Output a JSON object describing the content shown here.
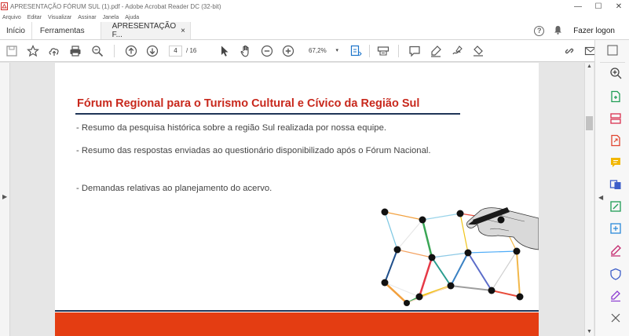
{
  "window": {
    "title": "APRESENTAÇÃO FÓRUM SUL (1).pdf - Adobe Acrobat Reader DC (32-bit)",
    "minimize": "—",
    "maximize": "☐",
    "close": "✕"
  },
  "menu": [
    "Arquivo",
    "Editar",
    "Visualizar",
    "Assinar",
    "Janela",
    "Ajuda"
  ],
  "tabs": {
    "home": "Início",
    "tools": "Ferramentas",
    "document": "APRESENTAÇÃO F...",
    "close_glyph": "×"
  },
  "header_right": {
    "help": "?",
    "login": "Fazer logon"
  },
  "toolbar": {
    "page_current": "4",
    "page_total": "/ 16",
    "zoom": "67,2%"
  },
  "slide": {
    "title": "Fórum Regional para o Turismo Cultural e Cívico da Região Sul",
    "bullets": [
      "- Resumo da pesquisa histórica sobre a região Sul realizada por nossa equipe.",
      "- Resumo das respostas enviadas ao questionário disponibilizado após o Fórum Nacional.",
      "- Demandas relativas ao planejamento do acervo."
    ]
  },
  "colors": {
    "title_red": "#c8281c",
    "rule_navy": "#1f3557",
    "footer_orange": "#e43d12"
  },
  "icons": [
    "pdf-icon",
    "save-icon",
    "star-icon",
    "cloud-upload-icon",
    "print-icon",
    "search-zoom-icon",
    "page-up-icon",
    "page-down-icon",
    "cursor-icon",
    "hand-icon",
    "zoom-out-icon",
    "zoom-in-icon",
    "fit-page-icon",
    "scan-icon",
    "comment-icon",
    "highlight-icon",
    "draw-icon",
    "stamp-icon",
    "link-icon",
    "email-icon",
    "bell-icon",
    "help-icon"
  ]
}
